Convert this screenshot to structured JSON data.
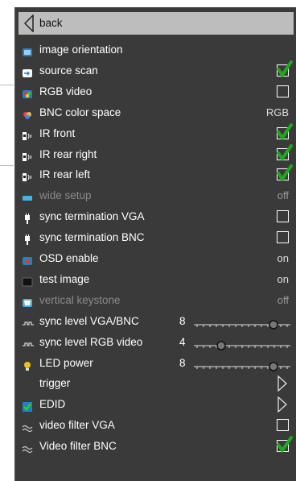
{
  "menu": {
    "back_label": "back",
    "items": [
      {
        "label": "image orientation",
        "type": "none",
        "icon": "image-orientation-icon"
      },
      {
        "label": "source scan",
        "type": "checkbox",
        "checked": true,
        "icon": "source-scan-icon"
      },
      {
        "label": "RGB video",
        "type": "checkbox",
        "checked": false,
        "icon": "rgb-video-icon"
      },
      {
        "label": "BNC color space",
        "type": "value",
        "value": "RGB",
        "icon": "color-space-icon"
      },
      {
        "label": "IR front",
        "type": "checkbox",
        "checked": true,
        "icon": "ir-sensor-icon"
      },
      {
        "label": "IR rear right",
        "type": "checkbox",
        "checked": true,
        "icon": "ir-sensor-icon"
      },
      {
        "label": "IR rear left",
        "type": "checkbox",
        "checked": true,
        "icon": "ir-sensor-icon"
      },
      {
        "label": "wide setup",
        "type": "value",
        "value": "off",
        "disabled": true,
        "icon": "wide-setup-icon"
      },
      {
        "label": "sync termination VGA",
        "type": "checkbox",
        "checked": false,
        "icon": "plug-icon"
      },
      {
        "label": "sync termination BNC",
        "type": "checkbox",
        "checked": false,
        "icon": "plug-icon"
      },
      {
        "label": "OSD enable",
        "type": "value",
        "value": "on",
        "icon": "osd-icon"
      },
      {
        "label": "test image",
        "type": "value",
        "value": "on",
        "icon": "test-image-icon"
      },
      {
        "label": "vertical keystone",
        "type": "value",
        "value": "off",
        "disabled": true,
        "icon": "keystone-icon"
      },
      {
        "label": "sync level VGA/BNC",
        "type": "slider",
        "value": "8",
        "level": 0.85,
        "icon": "sync-level-icon"
      },
      {
        "label": "sync level RGB video",
        "type": "slider",
        "value": "4",
        "level": 0.27,
        "icon": "sync-level-icon"
      },
      {
        "label": "LED power",
        "type": "slider",
        "value": "8",
        "level": 0.85,
        "icon": "bulb-icon"
      },
      {
        "label": "trigger",
        "type": "submenu",
        "icon": ""
      },
      {
        "label": "EDID",
        "type": "submenu",
        "icon": "checkmark-icon"
      },
      {
        "label": "video filter VGA",
        "type": "checkbox",
        "checked": false,
        "icon": "wave-icon"
      },
      {
        "label": "Video filter BNC",
        "type": "checkbox",
        "checked": true,
        "icon": "wave-icon"
      }
    ]
  },
  "colors": {
    "panel": "#3a3a3a",
    "selected": "#bdbdbd",
    "check_green": "#1ea81e",
    "disabled_text": "#8a8a8a"
  }
}
